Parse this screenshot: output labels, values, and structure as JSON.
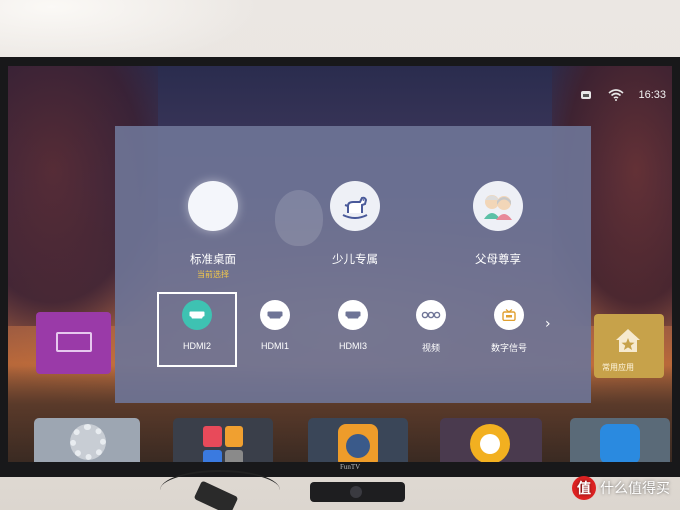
{
  "status_bar": {
    "time": "16:33",
    "icons": [
      "network-icon",
      "wifi-icon"
    ]
  },
  "background": {
    "tile_right_label": "常用应用",
    "brand_label": "FunTV"
  },
  "mode_dialog": {
    "modes": [
      {
        "label": "标准桌面",
        "sub": "当前选择",
        "icon": "blank-circle-icon",
        "selected": true
      },
      {
        "label": "少儿专属",
        "sub": "",
        "icon": "rocking-horse-icon",
        "selected": false
      },
      {
        "label": "父母尊享",
        "sub": "",
        "icon": "elderly-couple-icon",
        "selected": false
      }
    ],
    "sources": [
      {
        "label": "HDMI2",
        "icon": "hdmi-icon",
        "selected": true
      },
      {
        "label": "HDMI1",
        "icon": "hdmi-icon",
        "selected": false
      },
      {
        "label": "HDMI3",
        "icon": "hdmi-icon",
        "selected": false
      },
      {
        "label": "视频",
        "icon": "av-video-icon",
        "selected": false
      },
      {
        "label": "数字信号",
        "icon": "digital-tv-icon",
        "selected": false
      }
    ],
    "more_icon": "chevron-right-icon"
  },
  "watermark": {
    "badge": "值",
    "text": "什么值得买"
  },
  "colors": {
    "accent_selected": "#3ec2b2",
    "current_selection_text": "#f2c84a",
    "dialog_bg": "#6e7496"
  }
}
